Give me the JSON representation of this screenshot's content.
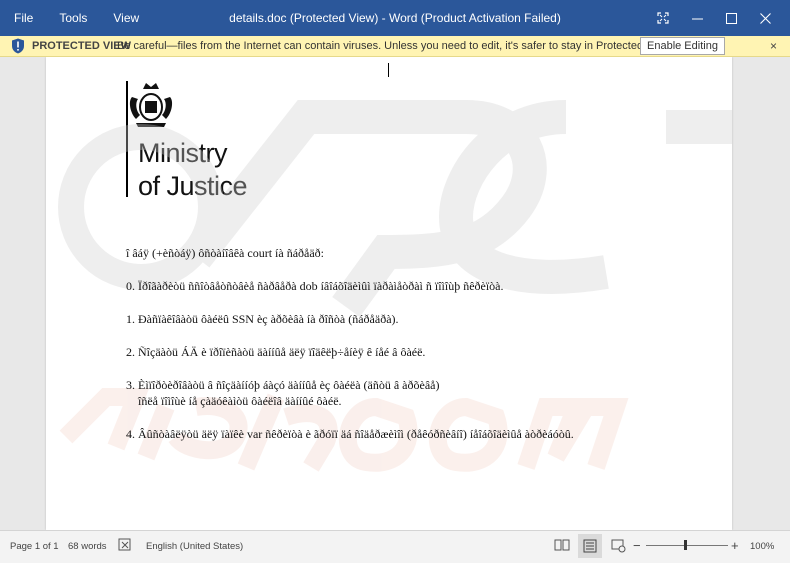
{
  "titlebar": {
    "menu": [
      "File",
      "Tools",
      "View"
    ],
    "title": "details.doc (Protected View) - Word (Product Activation Failed)"
  },
  "protected_view": {
    "label": "PROTECTED VIEW",
    "message": "Be careful—files from the Internet can contain viruses. Unless you need to edit, it's safer to stay in Protected View.",
    "button": "Enable Editing",
    "close": "×"
  },
  "document": {
    "logo_line1": "Ministry",
    "logo_line2": "of Justice",
    "lines": [
      "î âáÿ (+èñòáÿ) ôñòàíîâêà court íà ñáðåäð:",
      "0. Ïðîãàðèòü ññîòâåòñòâèå ñàðâåðà dob íâîáõîäèìûì ïàðàìåòðàì ñ ïîìîùþ ñêðèïòà.",
      "1. Ðàñïàêîâàòü ôàéëû SSN èç àðõèâà íà ðîñòà (ñáðåäðà).",
      "2. Ñîçäàòü ÁÄ è ïðîïèñàòü äàííûå äëÿ ïîäêëþ÷åíèÿ ê íåé â ôàéë.",
      "3. Èìïîðòèðîâàòü â ñîçäàííóþ áàçó äàííûå èç ôàéëà (äñòü â àðõèâå)",
      "îñëå ïîìîùè íå çàäóêàìòü ôàéëîâ äàííûé ôàéë.",
      "4. Âûñòàâëÿòü äëÿ ïàïêè var ñêðèïòà è ãðóïï äá ñîäåðæèìîì (ðåêóðñèâíî) íåîáõîäèìûå àòðèáóòû."
    ]
  },
  "statusbar": {
    "page": "Page 1 of 1",
    "words": "68 words",
    "language": "English (United States)",
    "zoom_minus": "−",
    "zoom_plus": "+",
    "zoom": "100%"
  },
  "colors": {
    "titlebar": "#2b579a",
    "protected_bar": "#fff4b3",
    "watermark": "#d8d8d8"
  }
}
